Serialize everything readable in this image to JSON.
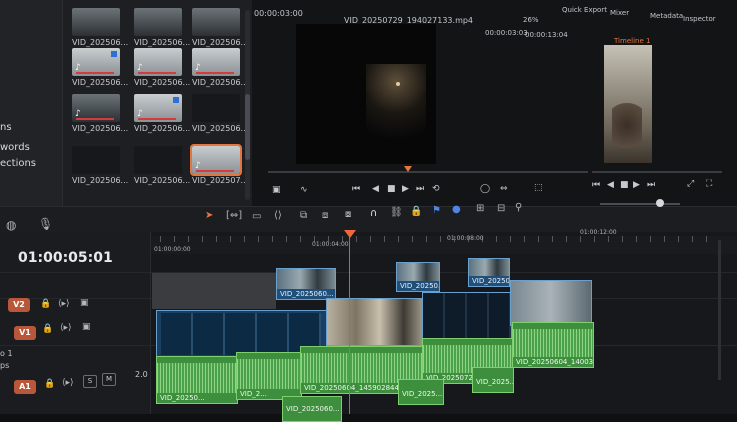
{
  "media_pool": {
    "sidebar": [
      "ns",
      "words",
      "ections"
    ],
    "clips": [
      {
        "label": "VID_202506...",
        "style": "mid",
        "audio": false,
        "badge": false
      },
      {
        "label": "VID_202506...",
        "style": "mid",
        "audio": false,
        "badge": false
      },
      {
        "label": "VID_202506...",
        "style": "mid",
        "audio": false,
        "badge": false
      },
      {
        "label": "VID_202506...",
        "style": "light",
        "audio": true,
        "badge": true
      },
      {
        "label": "VID_202506...",
        "style": "light",
        "audio": true,
        "badge": false
      },
      {
        "label": "VID_202506...",
        "style": "light",
        "audio": true,
        "badge": false
      },
      {
        "label": "VID_202506...",
        "style": "mid",
        "audio": true,
        "badge": false
      },
      {
        "label": "VID_202506...",
        "style": "light",
        "audio": true,
        "badge": true
      },
      {
        "label": "VID_202506...",
        "style": "dark",
        "audio": false,
        "badge": false
      },
      {
        "label": "VID_202506...",
        "style": "dark",
        "audio": false,
        "badge": false
      },
      {
        "label": "VID_202506...",
        "style": "dark",
        "audio": false,
        "badge": false
      },
      {
        "label": "VID_202507...",
        "style": "light",
        "audio": true,
        "badge": false,
        "selected": true
      }
    ]
  },
  "viewer": {
    "source_timecode": "00:00:03:00",
    "source_clip_name": "VID_20250729_194027133.mp4",
    "zoom": "26%",
    "timecode_a": "00:00:03:03",
    "timecode_b": "00:00:13:04",
    "timeline_name": "Timeline 1",
    "top_menu": [
      "Quick Export",
      "Mixer",
      "Metadata",
      "Inspector"
    ]
  },
  "timeline": {
    "timecode": "01:00:05:01",
    "ruler_labels": [
      "01:00:00:00",
      "01:00:04:00",
      "01:00:08:00",
      "01:00:12:00"
    ],
    "tracks": [
      {
        "badge": "V2",
        "kind": "video"
      },
      {
        "badge": "V1",
        "kind": "video"
      },
      {
        "badge": "A1",
        "kind": "audio",
        "level": "2.0"
      }
    ],
    "left_fragments": [
      "o 1",
      "ps"
    ],
    "v2_clips": [
      "VID_2025060...",
      "VID_20250...",
      "VID_20250..."
    ],
    "a1_clips": [
      "VID_20250...",
      "VID_2...",
      "VID_20250604_145902844...",
      "VID_20250729_194027133.mp4",
      "VID_20250604_140035..."
    ],
    "a2_clips": [
      "VID_2025060...",
      "VID_2025...",
      "VID_2025..."
    ],
    "mute_label": "M",
    "solo_label": "S"
  },
  "colors": {
    "accent": "#e3763f",
    "playhead": "#e2553a",
    "video_clip": "#1f4f7a",
    "audio_clip": "#3d8f3d"
  }
}
